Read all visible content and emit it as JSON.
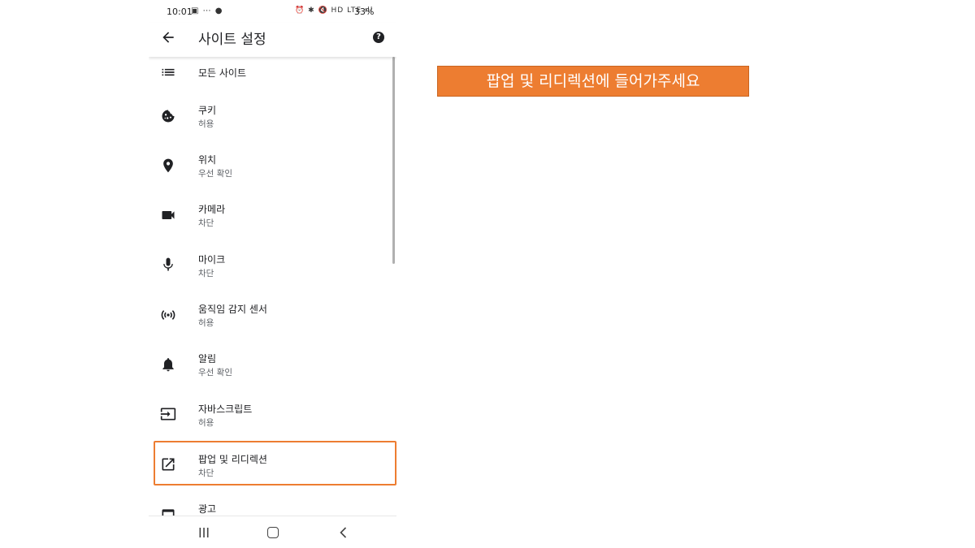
{
  "status_bar": {
    "time": "10:01",
    "left_icons": "▣ ⋯ ●",
    "right_icons": "⏰ ✱ 🔇 HD LTE ıll",
    "battery": "33%"
  },
  "app_bar": {
    "title": "사이트 설정",
    "help_glyph": "?"
  },
  "settings": [
    {
      "icon": "list-icon",
      "title": "모든 사이트"
    },
    {
      "icon": "cookie-icon",
      "title": "쿠키",
      "subtitle": "허용"
    },
    {
      "icon": "location-pin-icon",
      "title": "위치",
      "subtitle": "우선 확인"
    },
    {
      "icon": "video-camera-icon",
      "title": "카메라",
      "subtitle": "차단"
    },
    {
      "icon": "microphone-icon",
      "title": "마이크",
      "subtitle": "차단"
    },
    {
      "icon": "motion-sensor-icon",
      "title": "움직임 감지 센서",
      "subtitle": "허용"
    },
    {
      "icon": "bell-icon",
      "title": "알림",
      "subtitle": "우선 확인"
    },
    {
      "icon": "javascript-icon",
      "title": "자바스크립트",
      "subtitle": "허용"
    },
    {
      "icon": "open-external-icon",
      "title": "팝업 및 리디렉션",
      "subtitle": "차단"
    },
    {
      "icon": "ads-icon",
      "title": "광고"
    }
  ],
  "highlight_color": "#ed7d31",
  "instruction": "팝업 및 리디렉션에 들어가주세요",
  "nav_bar": {
    "icons": [
      "recent-apps-icon",
      "home-icon",
      "back-icon"
    ]
  }
}
